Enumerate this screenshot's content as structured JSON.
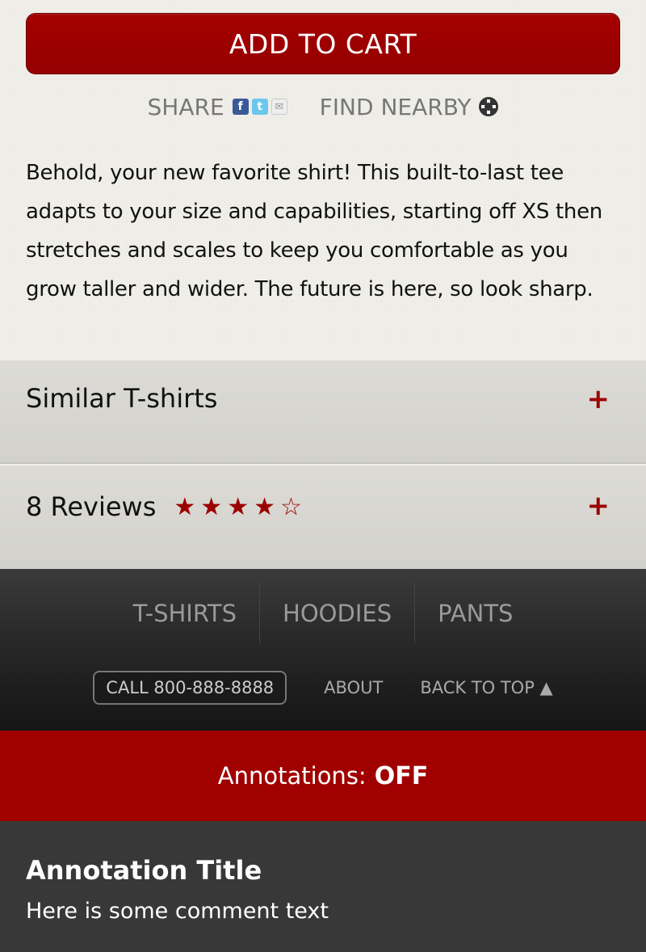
{
  "actions": {
    "add_to_cart": "ADD TO CART",
    "share_label": "SHARE",
    "find_nearby_label": "FIND NEARBY"
  },
  "icons": [
    "facebook-icon",
    "twitter-icon",
    "mail-icon",
    "crosshair-icon",
    "plus-icon",
    "star-icon"
  ],
  "description": "Behold, your new favorite shirt! This built-to-last tee adapts to your size and capabilities, starting off XS then stretches and scales to keep you comfortable as you grow taller and wider. The future is here, so look sharp.",
  "sections": {
    "similar": {
      "label": "Similar T-shirts",
      "toggle": "+"
    },
    "reviews": {
      "label": "8 Reviews",
      "toggle": "+",
      "rating": 4,
      "rating_max": 5
    }
  },
  "footer": {
    "nav": [
      "T-SHIRTS",
      "HOODIES",
      "PANTS"
    ],
    "call": "CALL 800-888-8888",
    "about": "ABOUT",
    "back_to_top": "BACK TO TOP ▲"
  },
  "annotations": {
    "toggle_label": "Annotations:",
    "toggle_state": "OFF",
    "title": "Annotation Title",
    "text": "Here is some comment text"
  },
  "colors": {
    "brand_red": "#a00000",
    "footer_dark": "#2a2a2a",
    "page_bg": "#f0efe9"
  }
}
